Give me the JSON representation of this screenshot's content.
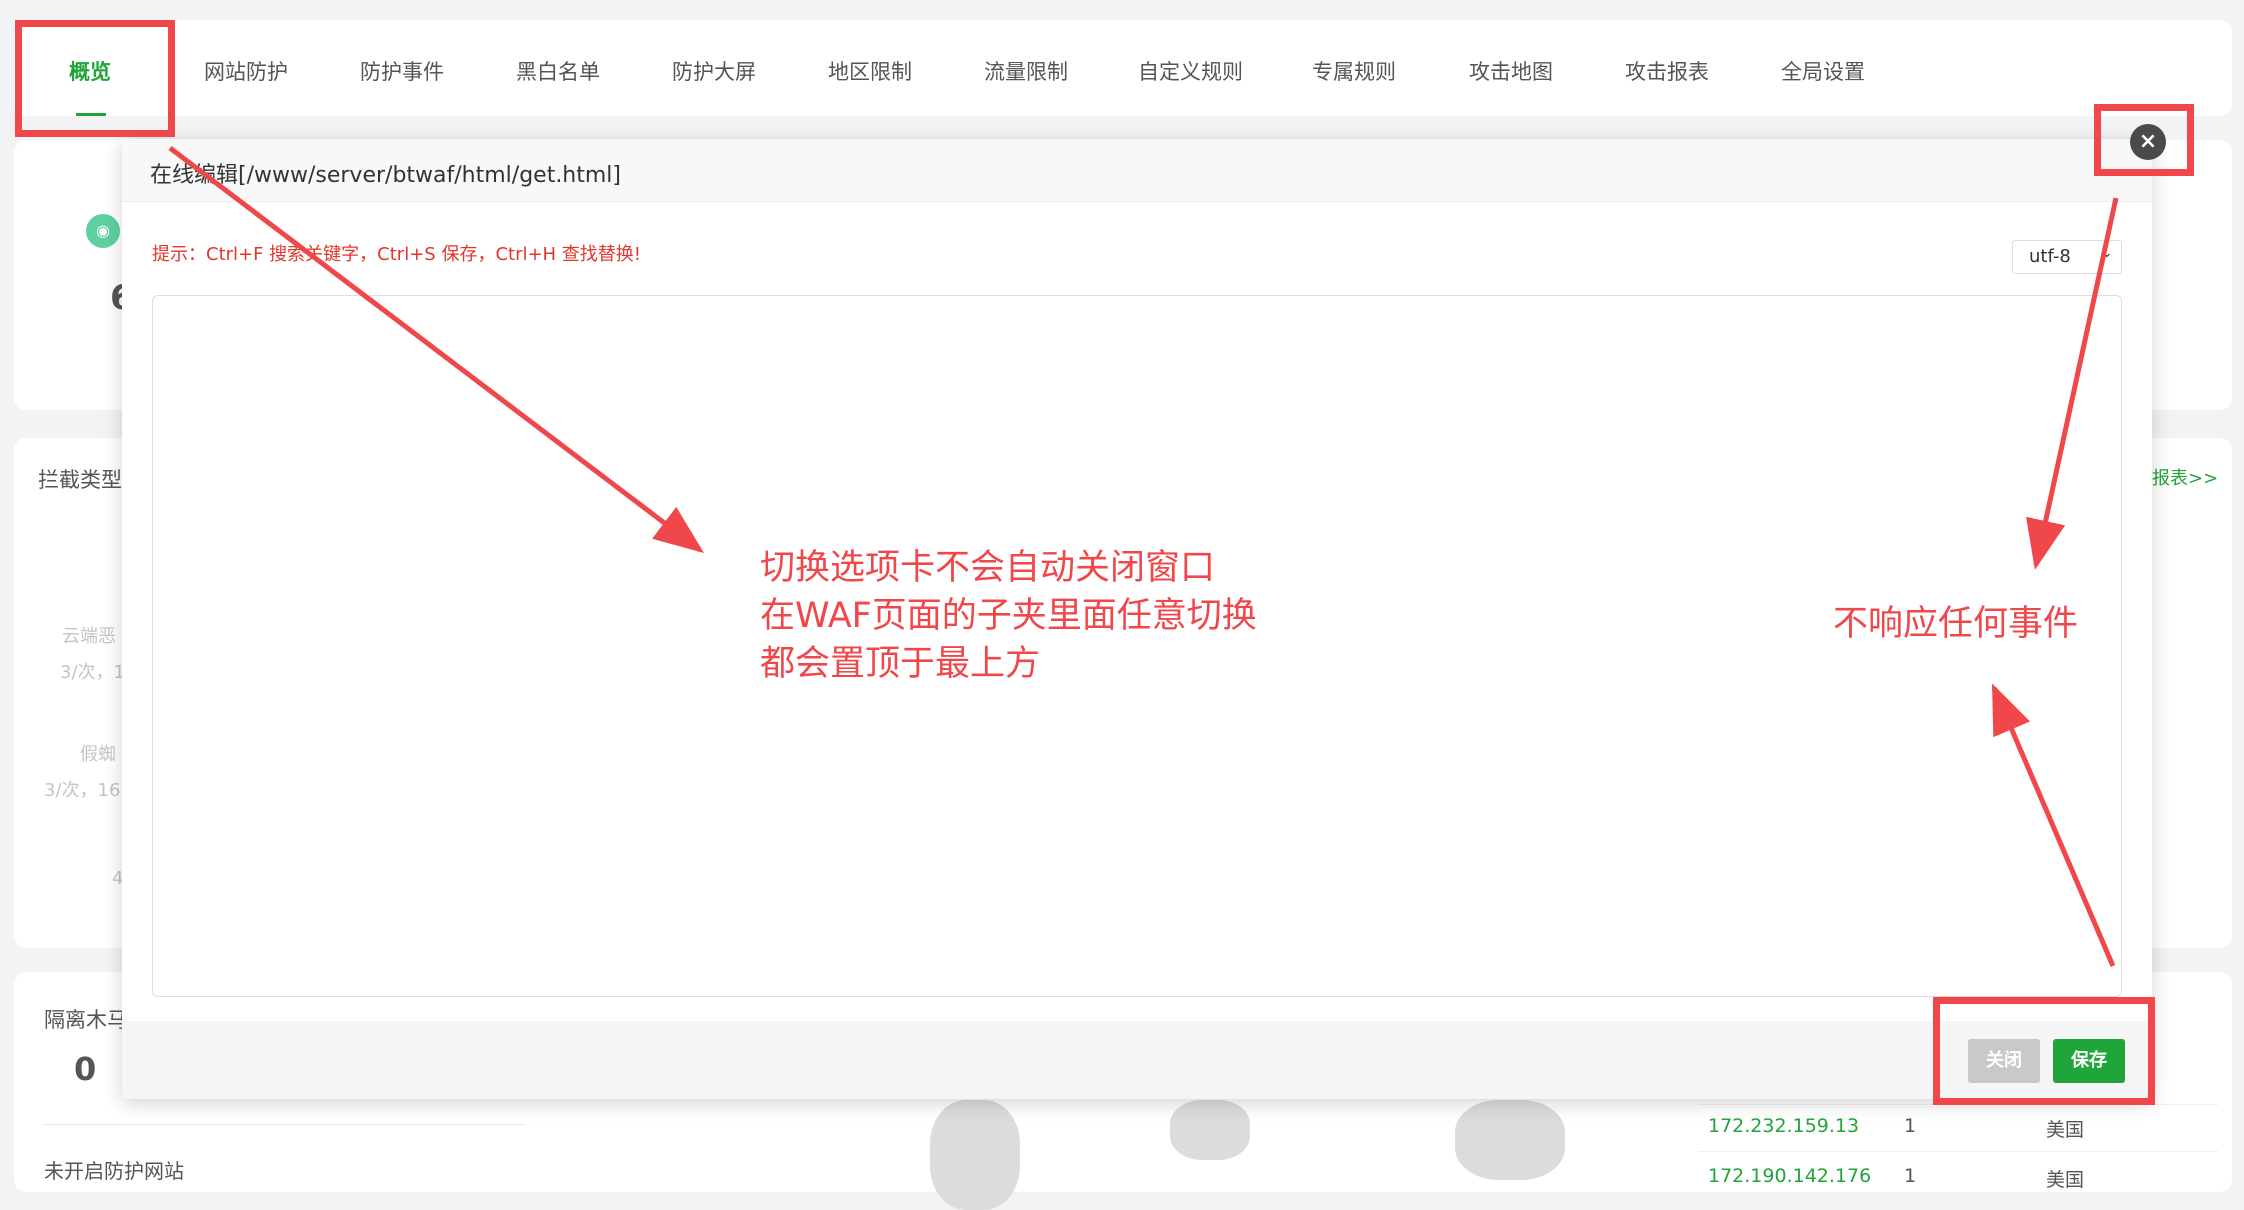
{
  "tabs": [
    {
      "label": "概览",
      "active": true
    },
    {
      "label": "网站防护"
    },
    {
      "label": "防护事件"
    },
    {
      "label": "黑白名单"
    },
    {
      "label": "防护大屏"
    },
    {
      "label": "地区限制"
    },
    {
      "label": "流量限制"
    },
    {
      "label": "自定义规则"
    },
    {
      "label": "专属规则"
    },
    {
      "label": "攻击地图"
    },
    {
      "label": "攻击报表"
    },
    {
      "label": "全局设置"
    }
  ],
  "background": {
    "block_type_label": "拦截类型",
    "report_link": "报表>>",
    "isolation_label": "隔离木马",
    "isolation_count": "0",
    "partial_number": "6",
    "faint_labels": [
      "云端恶",
      "3/次，1",
      "假蜘",
      "3/次，16",
      "4"
    ],
    "unprotected_label": "未开启防护网站",
    "ip_rows": [
      {
        "ip": "172.232.159.13",
        "count": "1",
        "country": "美国"
      },
      {
        "ip": "172.190.142.176",
        "count": "1",
        "country": "美国"
      }
    ]
  },
  "modal": {
    "title": "在线编辑[/www/server/btwaf/html/get.html]",
    "hint": "提示：Ctrl+F 搜索关键字，Ctrl+S 保存，Ctrl+H 查找替换!",
    "encoding": "utf-8",
    "close_button": "关闭",
    "save_button": "保存"
  },
  "annotations": {
    "main_note": [
      "切换选项卡不会自动关闭窗口",
      "在WAF页面的子夹里面任意切换",
      "都会置顶于最上方"
    ],
    "side_note": "不响应任何事件"
  },
  "colors": {
    "accent": "#20a53a",
    "annotation": "#f0474b",
    "hint": "#e0362b"
  }
}
